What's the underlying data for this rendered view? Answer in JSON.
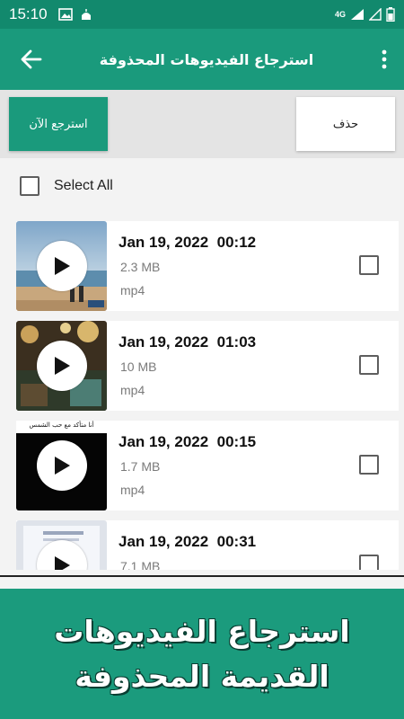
{
  "status_bar": {
    "time": "15:10",
    "network_label": "4G",
    "icons": [
      "image-icon",
      "mosque-icon",
      "signal-icon",
      "battery-icon"
    ]
  },
  "app_bar": {
    "title": "استرجاع الفيديوهات المحذوفة",
    "back_icon": "arrow-back-icon",
    "menu_icon": "more-vert-icon"
  },
  "actions": {
    "restore_now_label": "استرجع الآن",
    "delete_label": "حذف"
  },
  "select_all": {
    "label": "Select All",
    "checked": false
  },
  "videos": [
    {
      "date": "Jan 19, 2022  00:12",
      "size": "2.3 MB",
      "format": "mp4",
      "checked": false
    },
    {
      "date": "Jan 19, 2022  01:03",
      "size": "10 MB",
      "format": "mp4",
      "checked": false
    },
    {
      "date": "Jan 19, 2022  00:15",
      "size": "1.7 MB",
      "format": "mp4",
      "checked": false
    },
    {
      "date": "Jan 19, 2022  00:31",
      "size": "7.1 MB",
      "format": "",
      "checked": false
    }
  ],
  "thumbnail_caption": "أنا متأكد مع حب الشمس",
  "promo": {
    "line1": "استرجاع الفيديوهات",
    "line2": "القديمة المحذوفة"
  },
  "colors": {
    "primary": "#1a9a7c",
    "status_bar": "#12896d",
    "action_area": "#e4e4e4",
    "banner": "#1b9b7d"
  }
}
